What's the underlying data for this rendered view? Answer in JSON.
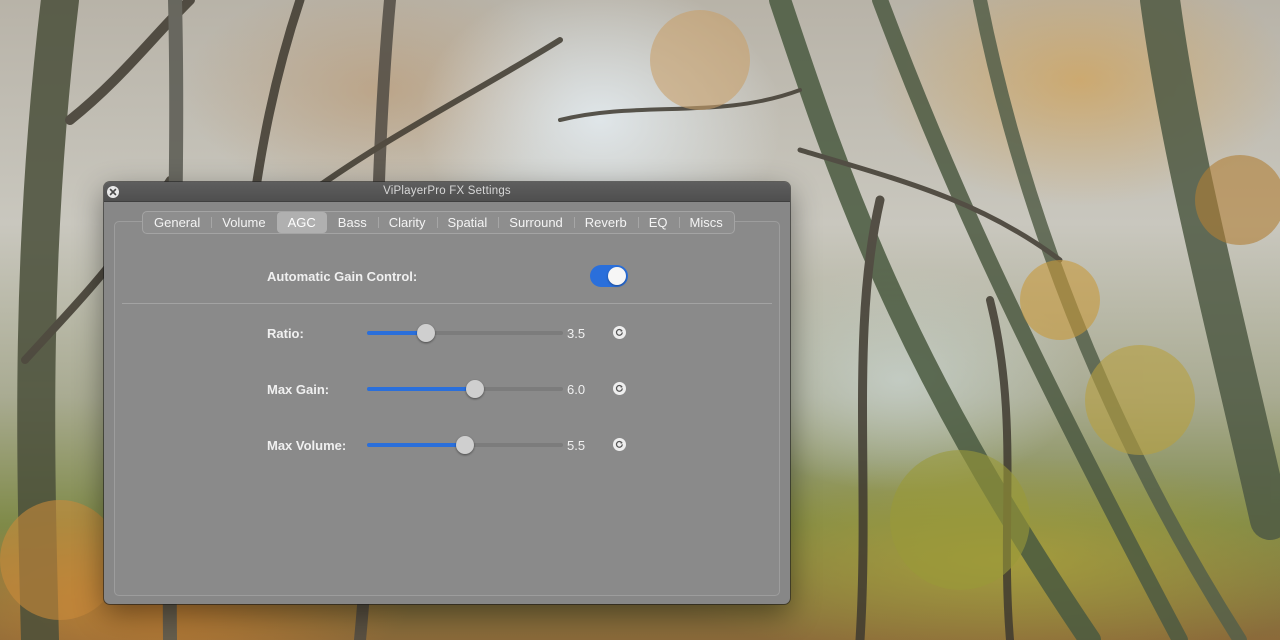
{
  "window": {
    "title": "ViPlayerPro FX Settings"
  },
  "tabs": [
    {
      "label": "General",
      "active": false
    },
    {
      "label": "Volume",
      "active": false
    },
    {
      "label": "AGC",
      "active": true
    },
    {
      "label": "Bass",
      "active": false
    },
    {
      "label": "Clarity",
      "active": false
    },
    {
      "label": "Spatial",
      "active": false
    },
    {
      "label": "Surround",
      "active": false
    },
    {
      "label": "Reverb",
      "active": false
    },
    {
      "label": "EQ",
      "active": false
    },
    {
      "label": "Miscs",
      "active": false
    }
  ],
  "agc": {
    "label": "Automatic Gain Control:",
    "enabled": true
  },
  "controls": [
    {
      "label": "Ratio:",
      "value": "3.5",
      "level": 0.3
    },
    {
      "label": "Max Gain:",
      "value": "6.0",
      "level": 0.55
    },
    {
      "label": "Max Volume:",
      "value": "5.5",
      "level": 0.5
    }
  ],
  "colors": {
    "accent": "#2a6fdb",
    "window_bg": "#878787",
    "titlebar": "#555555"
  },
  "icons": {
    "close": "close-icon",
    "reset": "reset-icon"
  }
}
